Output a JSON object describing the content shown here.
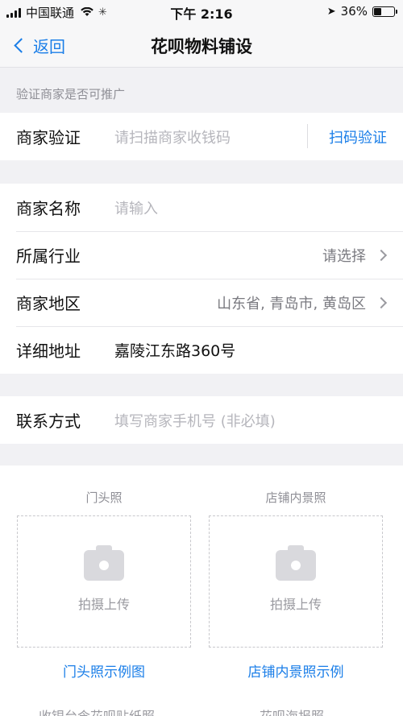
{
  "status_bar": {
    "carrier": "中国联通",
    "time": "下午 2:16",
    "battery": "36%",
    "battery_level": 0.36
  },
  "nav": {
    "back_label": "返回",
    "title": "花呗物料铺设"
  },
  "verify_section": {
    "header": "验证商家是否可推广",
    "label": "商家验证",
    "placeholder": "请扫描商家收钱码",
    "scan_button": "扫码验证"
  },
  "merchant": {
    "name_label": "商家名称",
    "name_placeholder": "请输入",
    "industry_label": "所属行业",
    "industry_value": "请选择",
    "region_label": "商家地区",
    "region_value": "山东省, 青岛市, 黄岛区",
    "address_label": "详细地址",
    "address_value": "嘉陵江东路360号"
  },
  "contact": {
    "label": "联系方式",
    "placeholder": "填写商家手机号 (非必填)"
  },
  "photos": [
    {
      "caption": "门头照",
      "upload": "拍摄上传",
      "example": "门头照示例图"
    },
    {
      "caption": "店铺内景照",
      "upload": "拍摄上传",
      "example": "店铺内景照示例"
    }
  ],
  "more_photos": [
    "收银台含花呗贴纸照",
    "花呗海报照"
  ]
}
